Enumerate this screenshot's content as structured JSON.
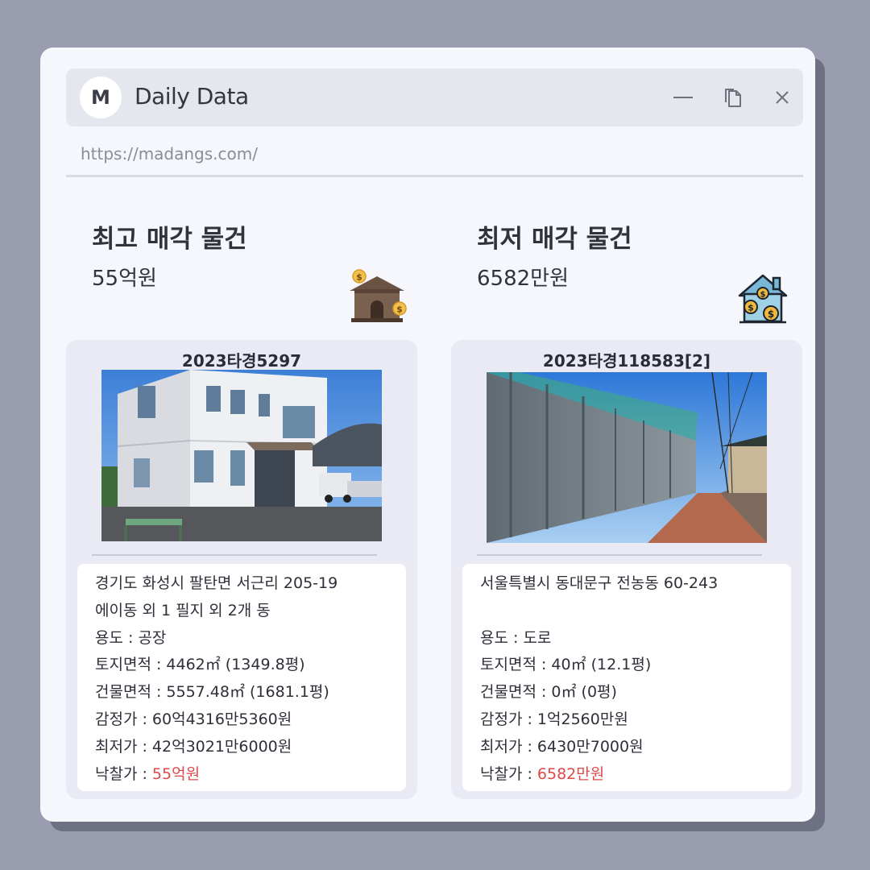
{
  "window": {
    "logo_letter": "M",
    "title": "Daily Data",
    "url": "https://madangs.com/"
  },
  "icons": {
    "minimize": "minimize-icon",
    "restore": "restore-icon",
    "close": "close-icon",
    "high_house": "house-money-icon",
    "low_house": "house-coins-icon"
  },
  "colors": {
    "accent_red": "#e04848",
    "card_bg": "#e9eaf3",
    "window_bg": "#f6f7fd"
  },
  "highest": {
    "heading": "최고 매각 물건",
    "price": "55억원",
    "case_no": "2023타경5297",
    "address1": "경기도 화성시 팔탄면 서근리 205-19",
    "address2": "에이동 외 1 필지 외 2개 동",
    "usage_label": "용도 : ",
    "usage": "공장",
    "land_label": "토지면적 : ",
    "land": "4462㎡ (1349.8평)",
    "building_label": "건물면적 : ",
    "building": "5557.48㎡ (1681.1평)",
    "appraisal_label": "감정가 : ",
    "appraisal": "60억4316만5360원",
    "minimum_label": "최저가 : ",
    "minimum": "42억3021만6000원",
    "winning_label": "낙찰가 : ",
    "winning": "55억원"
  },
  "lowest": {
    "heading": "최저 매각 물건",
    "price": "6582만원",
    "case_no": "2023타경118583[2]",
    "address1": "서울특별시 동대문구 전농동 60-243",
    "address2": "",
    "usage_label": "용도 :  ",
    "usage": "도로",
    "land_label": "토지면적 : ",
    "land": "40㎡ (12.1평)",
    "building_label": "건물면적 : ",
    "building": "0㎡ (0평)",
    "appraisal_label": "감정가 : ",
    "appraisal": "1억2560만원",
    "minimum_label": "최저가 : ",
    "minimum": "6430만7000원",
    "winning_label": "낙찰가 : ",
    "winning": "6582만원"
  }
}
